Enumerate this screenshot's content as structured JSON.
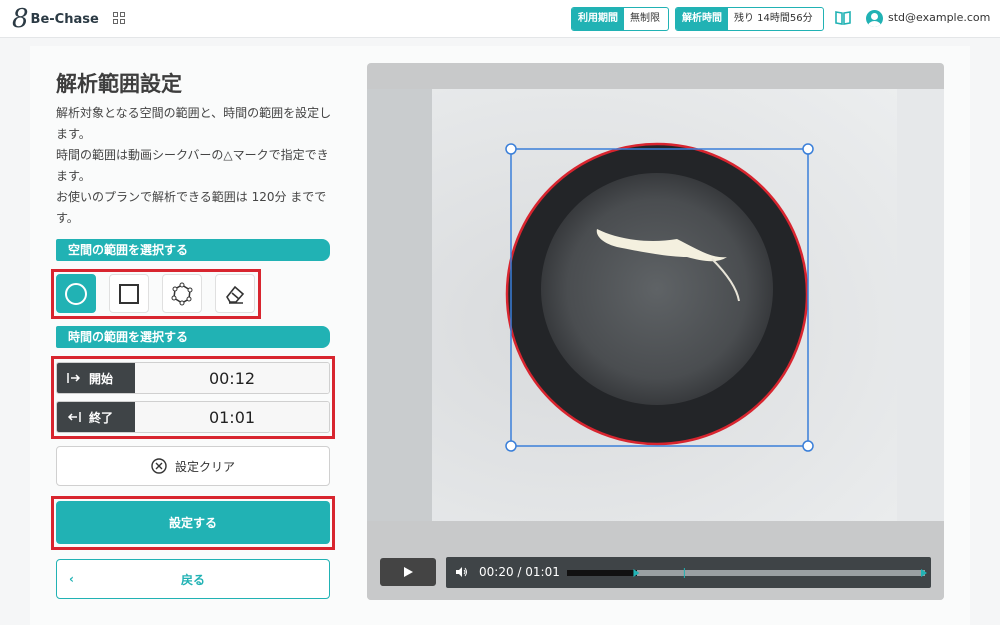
{
  "header": {
    "logo_mark": "8",
    "logo_text": "Be-Chase",
    "usage_period_label": "利用期間",
    "usage_period_value": "無制限",
    "analysis_time_label": "解析時間",
    "analysis_time_value": "残り 14時間56分",
    "user_email": "std@example.com"
  },
  "main": {
    "title": "解析範囲設定",
    "description": [
      "解析対象となる空間の範囲と、時間の範囲を設定します。",
      "時間の範囲は動画シークバーの△マークで指定できます。",
      "お使いのプランで解析できる範囲は 120分 までです。"
    ],
    "space_section_label": "空間の範囲を選択する",
    "time_section_label": "時間の範囲を選択する",
    "tools": [
      "circle-icon",
      "square-icon",
      "polygon-icon",
      "eraser-icon"
    ],
    "start_label": "開始",
    "start_value": "00:12",
    "end_label": "終了",
    "end_value": "01:01",
    "clear_label": "設定クリア",
    "set_label": "設定する",
    "back_label": "戻る"
  },
  "player": {
    "timecode": "00:20 / 01:01",
    "current_seconds": 20,
    "duration_seconds": 61,
    "range_start_seconds": 12,
    "range_end_seconds": 61
  },
  "colors": {
    "accent": "#21b2b4",
    "highlight": "#d8252f",
    "selection": "#3a7fd9"
  }
}
